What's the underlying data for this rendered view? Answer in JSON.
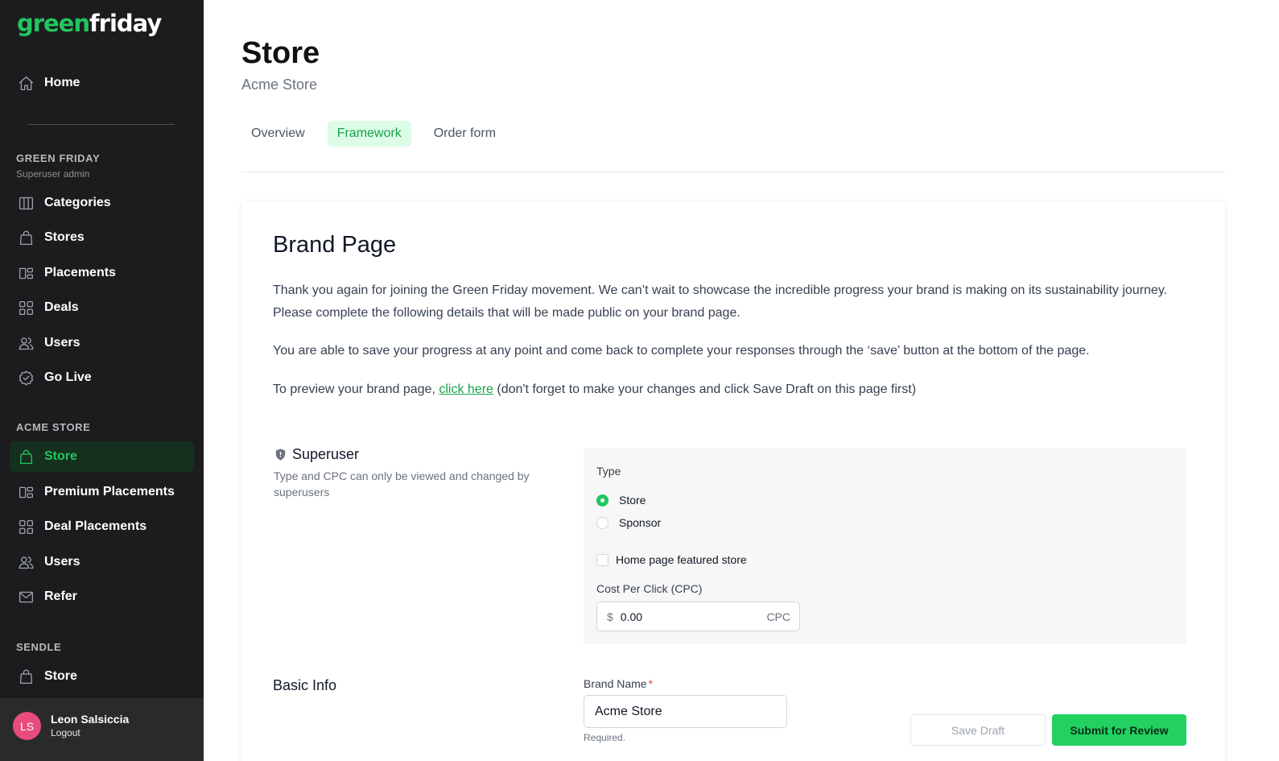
{
  "brand": {
    "logo_green": "green",
    "logo_white": "friday",
    "accent_color": "#22c55e"
  },
  "sidebar": {
    "home": {
      "label": "Home",
      "icon": "home-icon"
    },
    "green_friday_section": {
      "title": "GREEN FRIDAY",
      "subtitle": "Superuser admin",
      "items": [
        {
          "label": "Categories",
          "icon": "columns-icon"
        },
        {
          "label": "Stores",
          "icon": "shopping-bag-icon"
        },
        {
          "label": "Placements",
          "icon": "placements-icon"
        },
        {
          "label": "Deals",
          "icon": "grid-icon"
        },
        {
          "label": "Users",
          "icon": "users-icon"
        },
        {
          "label": "Go Live",
          "icon": "check-badge-icon"
        }
      ]
    },
    "acme_section": {
      "title": "ACME STORE",
      "items": [
        {
          "label": "Store",
          "icon": "shopping-bag-icon",
          "active": true
        },
        {
          "label": "Premium Placements",
          "icon": "placements-icon"
        },
        {
          "label": "Deal Placements",
          "icon": "grid-icon"
        },
        {
          "label": "Users",
          "icon": "users-icon"
        },
        {
          "label": "Refer",
          "icon": "mail-icon"
        }
      ]
    },
    "sendle_section": {
      "title": "SENDLE",
      "items": [
        {
          "label": "Store",
          "icon": "shopping-bag-icon"
        }
      ]
    },
    "user": {
      "initials": "LS",
      "name": "Leon Salsiccia",
      "logout": "Logout",
      "avatar_color": "#e84c7c"
    }
  },
  "header": {
    "title": "Store",
    "subtitle": "Acme Store"
  },
  "tabs": [
    {
      "label": "Overview",
      "active": false
    },
    {
      "label": "Framework",
      "active": true
    },
    {
      "label": "Order form",
      "active": false
    }
  ],
  "card": {
    "title": "Brand Page",
    "intro_line1": "Thank you again for joining the Green Friday movement. We can’t wait to showcase the incredible progress your brand is making on its sustainability journey.",
    "intro_line2": "Please complete the following details that will be made public on your brand page.",
    "save_note": "You are able to save your progress at any point and come back to complete your responses through the ‘save’ button at the bottom of the page.",
    "preview_prefix": "To preview your brand page, ",
    "preview_link": "click here",
    "preview_suffix": " (don't forget to make your changes and click Save Draft on this page first)"
  },
  "superuser": {
    "title": "Superuser",
    "icon": "shield-icon",
    "description": "Type and CPC can only be viewed and changed by superusers",
    "type_label": "Type",
    "type_options": [
      {
        "label": "Store",
        "selected": true
      },
      {
        "label": "Sponsor",
        "selected": false
      }
    ],
    "featured_label": "Home page featured store",
    "featured_checked": false,
    "cpc_label": "Cost Per Click (CPC)",
    "cpc_prefix": "$",
    "cpc_value": "0.00",
    "cpc_suffix": "CPC"
  },
  "basic_info": {
    "title": "Basic Info",
    "brand_name_label": "Brand Name",
    "required_mark": "*",
    "brand_name_value": "Acme Store",
    "brand_name_help": "Required."
  },
  "actions": {
    "save_draft": "Save Draft",
    "submit": "Submit for Review"
  }
}
